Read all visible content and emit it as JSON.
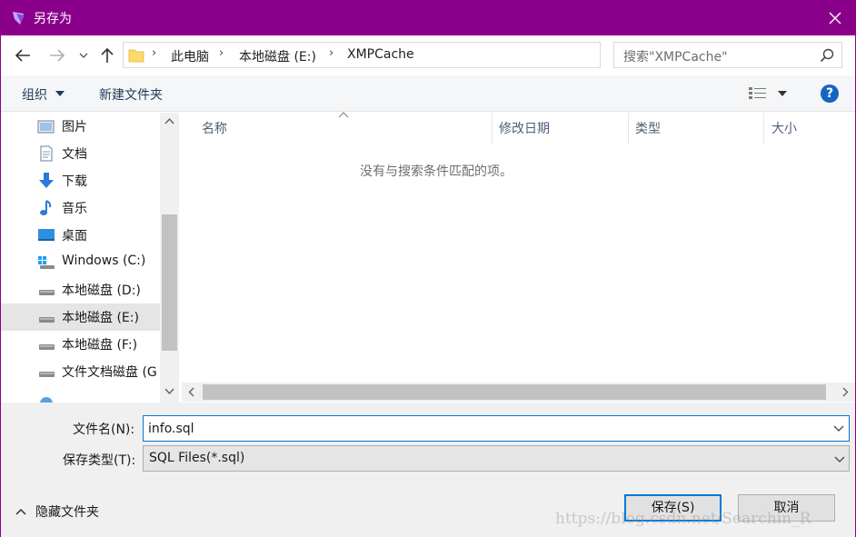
{
  "window": {
    "title": "另存为",
    "accent_color": "#8b008b"
  },
  "address": {
    "breadcrumbs": [
      "此电脑",
      "本地磁盘 (E:)",
      "XMPCache"
    ],
    "search_placeholder": "搜索\"XMPCache\""
  },
  "toolbar": {
    "organize_label": "组织",
    "new_folder_label": "新建文件夹"
  },
  "sidebar": {
    "items": [
      {
        "label": "图片",
        "icon": "pictures-icon"
      },
      {
        "label": "文档",
        "icon": "documents-icon"
      },
      {
        "label": "下载",
        "icon": "downloads-icon"
      },
      {
        "label": "音乐",
        "icon": "music-icon"
      },
      {
        "label": "桌面",
        "icon": "desktop-icon"
      },
      {
        "label": "Windows (C:)",
        "icon": "windows-drive-icon"
      },
      {
        "label": "本地磁盘 (D:)",
        "icon": "drive-icon"
      },
      {
        "label": "本地磁盘 (E:)",
        "icon": "drive-icon",
        "selected": true
      },
      {
        "label": "本地磁盘 (F:)",
        "icon": "drive-icon"
      },
      {
        "label": "文件文档磁盘 (G",
        "icon": "drive-icon"
      }
    ]
  },
  "filelist": {
    "columns": [
      "名称",
      "修改日期",
      "类型",
      "大小"
    ],
    "empty_message": "没有与搜索条件匹配的项。"
  },
  "form": {
    "filename_label": "文件名(N):",
    "filename_value": "info.sql",
    "filetype_label": "保存类型(T):",
    "filetype_value": "SQL Files(*.sql)"
  },
  "footer": {
    "hide_folders_label": "隐藏文件夹",
    "save_label": "保存(S)",
    "cancel_label": "取消"
  },
  "watermark": "https://blog.csdn.net/Searchin_R"
}
